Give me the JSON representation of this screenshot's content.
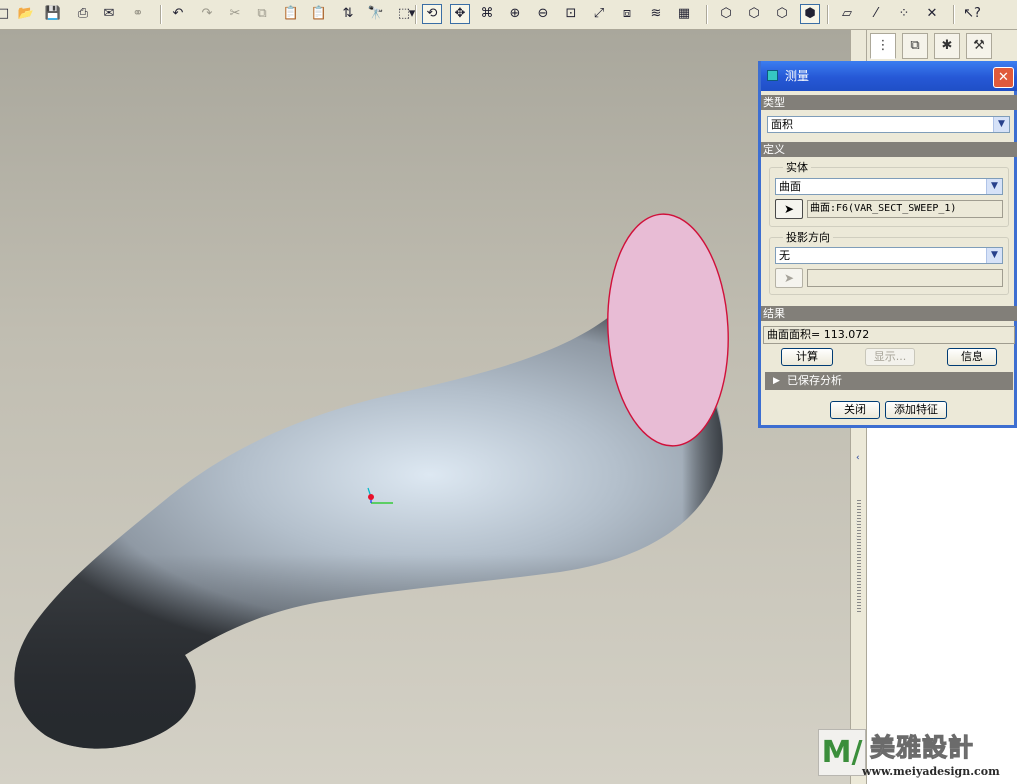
{
  "toolbar": {
    "buttons": [
      {
        "name": "new-icon",
        "glyph": "□"
      },
      {
        "name": "open-icon",
        "glyph": "📂"
      },
      {
        "name": "save-icon",
        "glyph": "💾"
      },
      {
        "name": "print-icon",
        "glyph": "⎙"
      },
      {
        "name": "email-icon",
        "glyph": "✉"
      },
      {
        "name": "email-link-icon",
        "glyph": "⚭"
      },
      {
        "name": "undo-icon",
        "glyph": "↶"
      },
      {
        "name": "redo-icon",
        "glyph": "↷"
      },
      {
        "name": "cut-icon",
        "glyph": "✂"
      },
      {
        "name": "copy-icon",
        "glyph": "⧉"
      },
      {
        "name": "paste-icon",
        "glyph": "📋"
      },
      {
        "name": "paste-special-icon",
        "glyph": "📋"
      },
      {
        "name": "regenerate-icon",
        "glyph": "⇅"
      },
      {
        "name": "find-icon",
        "glyph": "🔭"
      },
      {
        "name": "select-box-icon",
        "glyph": "⬚"
      },
      {
        "name": "select-dropdown-icon",
        "glyph": "▾"
      },
      {
        "name": "redraw-icon",
        "glyph": "⟲"
      },
      {
        "name": "spin-center-icon",
        "glyph": "✥"
      },
      {
        "name": "orient-mode-icon",
        "glyph": "⌘"
      },
      {
        "name": "zoom-in-icon",
        "glyph": "⊕"
      },
      {
        "name": "zoom-out-icon",
        "glyph": "⊖"
      },
      {
        "name": "refit-icon",
        "glyph": "⊡"
      },
      {
        "name": "reorient-icon",
        "glyph": "⤢"
      },
      {
        "name": "saved-views-icon",
        "glyph": "⧈"
      },
      {
        "name": "layers-icon",
        "glyph": "≋"
      },
      {
        "name": "view-manager-icon",
        "glyph": "▦"
      },
      {
        "name": "wireframe-icon",
        "glyph": "⬡"
      },
      {
        "name": "hidden-line-icon",
        "glyph": "⬡"
      },
      {
        "name": "no-hidden-icon",
        "glyph": "⬡"
      },
      {
        "name": "shading-icon",
        "glyph": "⬢"
      },
      {
        "name": "datum-planes-icon",
        "glyph": "▱"
      },
      {
        "name": "datum-axes-icon",
        "glyph": "⁄"
      },
      {
        "name": "datum-points-icon",
        "glyph": "⁘"
      },
      {
        "name": "coord-sys-icon",
        "glyph": "✕"
      },
      {
        "name": "context-help-icon",
        "glyph": "↖?"
      }
    ]
  },
  "dialog": {
    "title": "测量",
    "close_glyph": "✕",
    "section_type": "类型",
    "type_value": "面积",
    "section_definition": "定义",
    "group_entity": "实体",
    "entity_value": "曲面",
    "entity_selected": "曲面:F6(VAR_SECT_SWEEP_1)",
    "group_projection": "投影方向",
    "projection_value": "无",
    "projection_selected": "",
    "section_result": "结果",
    "result_text": "曲面面积= 113.072",
    "btn_compute": "计算",
    "btn_show": "显示...",
    "btn_info": "信息",
    "saved_analysis": "已保存分析",
    "btn_close": "关闭",
    "btn_add_feature": "添加特征",
    "arrow_glyph": "▼",
    "cursor_glyph": "➤"
  },
  "model_tree": {
    "tabs": [
      {
        "name": "model-tree-tab-icon",
        "glyph": "⋮"
      },
      {
        "name": "folder-browser-tab-icon",
        "glyph": "⧉"
      },
      {
        "name": "favorites-tab-icon",
        "glyph": "✱"
      },
      {
        "name": "connections-tab-icon",
        "glyph": "⚒"
      }
    ]
  },
  "watermark": {
    "logo_m": "M",
    "logo_slash": "/",
    "text_cn": "美雅設計",
    "url": "www.meiyadesign.com"
  },
  "colors": {
    "tube_light": "#dde8f2",
    "tube_mid": "#8f99a4",
    "tube_dark": "#3d4146",
    "end_face": "#e8bcd5",
    "end_face_edge": "#d0103a",
    "dialog_frame": "#3d6ed1"
  }
}
